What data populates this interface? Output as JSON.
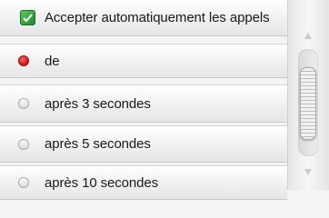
{
  "header": {
    "label": "Accepter automatiquement les appels"
  },
  "options": [
    {
      "label": "de",
      "selected": true
    },
    {
      "label": "après 3 secondes",
      "selected": false
    },
    {
      "label": "après 5 secondes",
      "selected": false
    },
    {
      "label": "après 10 secondes",
      "selected": false
    }
  ],
  "colors": {
    "checkbox": "#2aa036",
    "radio_selected": "#d21a1a"
  },
  "icons": {
    "checkbox": "checkmark-icon",
    "scroll_up": "chevron-up-icon",
    "scroll_down": "chevron-down-icon"
  }
}
